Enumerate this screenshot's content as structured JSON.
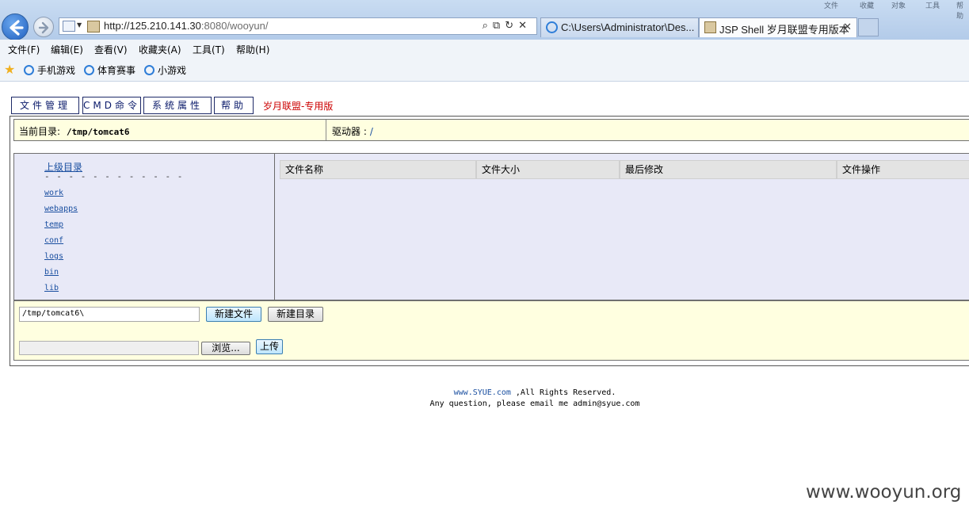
{
  "browser": {
    "window_controls": [
      "文件",
      "收藏",
      "对象",
      "工具",
      "帮助"
    ],
    "address": {
      "host": "http://125.210.141.30",
      "rest": ":8080/wooyun/"
    },
    "tabs": [
      {
        "label": "C:\\Users\\Administrator\\Des..."
      },
      {
        "label": "JSP Shell 岁月联盟专用版本",
        "close": "✕"
      }
    ],
    "menu": [
      "文件(F)",
      "编辑(E)",
      "查看(V)",
      "收藏夹(A)",
      "工具(T)",
      "帮助(H)"
    ],
    "favorites": [
      "手机游戏",
      "体育赛事",
      "小游戏"
    ]
  },
  "page": {
    "nav": [
      "文件管理",
      "CMD命令",
      "系统属性",
      "帮助"
    ],
    "brand": "岁月联盟-专用版",
    "current_dir_label": "当前目录:",
    "current_dir": "/tmp/tomcat6",
    "drive_label": "驱动器 :",
    "drive": "/",
    "parent_dir": "上级目录",
    "dashes": "- - - - - - - - - - - -",
    "dirs": [
      "work",
      "webapps",
      "temp",
      "conf",
      "logs",
      "bin",
      "lib"
    ],
    "columns": [
      "文件名称",
      "文件大小",
      "最后修改",
      "文件操作"
    ],
    "path_value": "/tmp/tomcat6\\",
    "new_file": "新建文件",
    "new_dir": "新建目录",
    "browse": "浏览...",
    "upload": "上传",
    "footer": {
      "site": "www.SYUE.com",
      "rights": " ,All Rights Reserved.",
      "contact": "Any question, please email me admin@syue.com"
    }
  },
  "watermark": "www.wooyun.org"
}
